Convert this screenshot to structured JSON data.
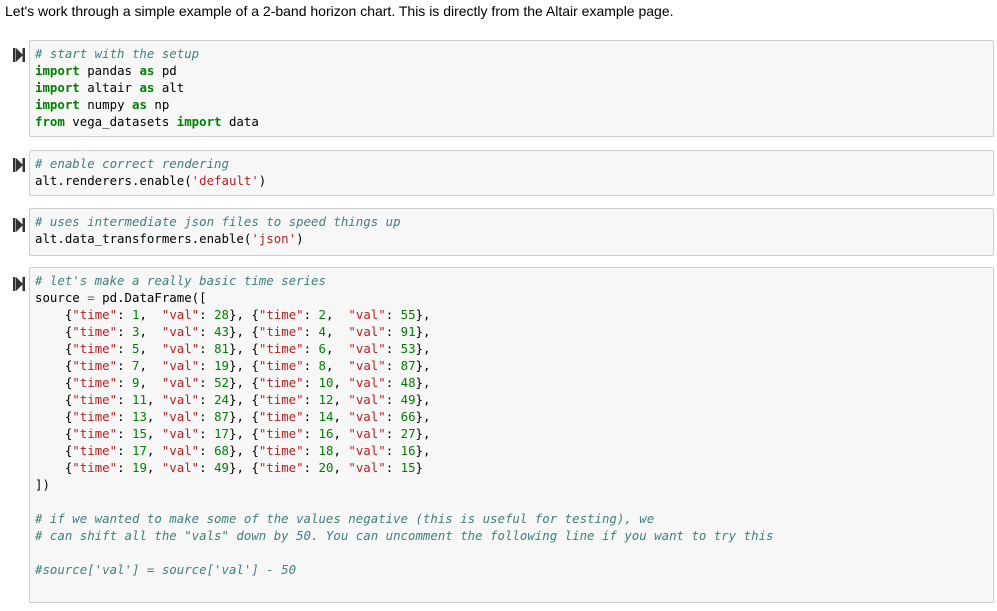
{
  "intro_text": "Let's work through a simple example of a 2-band horizon chart. This is directly from the Altair example page.",
  "cells": [
    {
      "lines": [
        "# start with the setup",
        "import pandas as pd",
        "import altair as alt",
        "import numpy as np",
        "from vega_datasets import data"
      ]
    },
    {
      "lines": [
        "# enable correct rendering",
        "alt.renderers.enable('default')"
      ]
    },
    {
      "lines": [
        "# uses intermediate json files to speed things up",
        "alt.data_transformers.enable('json')"
      ]
    },
    {
      "lines": [
        "# let's make a really basic time series",
        "source = pd.DataFrame([",
        "    {\"time\": 1,  \"val\": 28}, {\"time\": 2,  \"val\": 55},",
        "    {\"time\": 3,  \"val\": 43}, {\"time\": 4,  \"val\": 91},",
        "    {\"time\": 5,  \"val\": 81}, {\"time\": 6,  \"val\": 53},",
        "    {\"time\": 7,  \"val\": 19}, {\"time\": 8,  \"val\": 87},",
        "    {\"time\": 9,  \"val\": 52}, {\"time\": 10, \"val\": 48},",
        "    {\"time\": 11, \"val\": 24}, {\"time\": 12, \"val\": 49},",
        "    {\"time\": 13, \"val\": 87}, {\"time\": 14, \"val\": 66},",
        "    {\"time\": 15, \"val\": 17}, {\"time\": 16, \"val\": 27},",
        "    {\"time\": 17, \"val\": 68}, {\"time\": 18, \"val\": 16},",
        "    {\"time\": 19, \"val\": 49}, {\"time\": 20, \"val\": 15}",
        "])",
        "",
        "# if we wanted to make some of the values negative (this is useful for testing), we",
        "# can shift all the \"vals\" down by 50. You can uncomment the following line if you want to try this",
        "",
        "#source['val'] = source['val'] - 50"
      ]
    }
  ],
  "colors": {
    "keyword": "#008000",
    "comment": "#408080",
    "string": "#ba2121",
    "cell_background": "#f7f7f7",
    "cell_border": "#cfcfcf"
  },
  "icons": {
    "run_button": "run-cell-icon"
  }
}
